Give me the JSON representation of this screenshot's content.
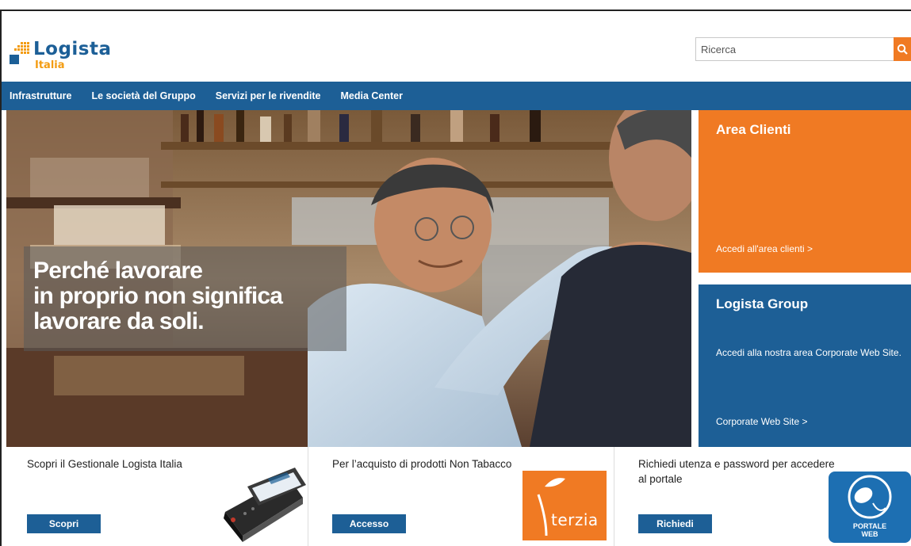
{
  "header": {
    "logo_main": "Logista",
    "logo_sub": "Italia",
    "search_placeholder": "Ricerca",
    "search_icon": "search-icon"
  },
  "nav": {
    "items": [
      "Infrastrutture",
      "Le società del Gruppo",
      "Servizi per le rivendite",
      "Media Center"
    ]
  },
  "hero": {
    "line1": "Perché lavorare",
    "line2": "in proprio non significa",
    "line3": "lavorare da soli."
  },
  "panels": {
    "area_clienti": {
      "title": "Area Clienti",
      "link": "Accedi all'area clienti >"
    },
    "logista_group": {
      "title": "Logista Group",
      "description": "Accedi alla nostra area Corporate Web Site.",
      "link": "Corporate Web Site >"
    }
  },
  "cards": [
    {
      "text": "Scopri il Gestionale Logista Italia",
      "button": "Scopri"
    },
    {
      "text": "Per l’acquisto di prodotti Non Tabacco",
      "button": "Accesso",
      "logo_text": "terzia"
    },
    {
      "text": "Richiedi utenza e password per accedere al portale",
      "button": "Richiedi",
      "badge_line1": "PORTALE",
      "badge_line2": "WEB"
    }
  ],
  "colors": {
    "brand_blue": "#1d5f96",
    "accent_orange": "#f07a23"
  }
}
